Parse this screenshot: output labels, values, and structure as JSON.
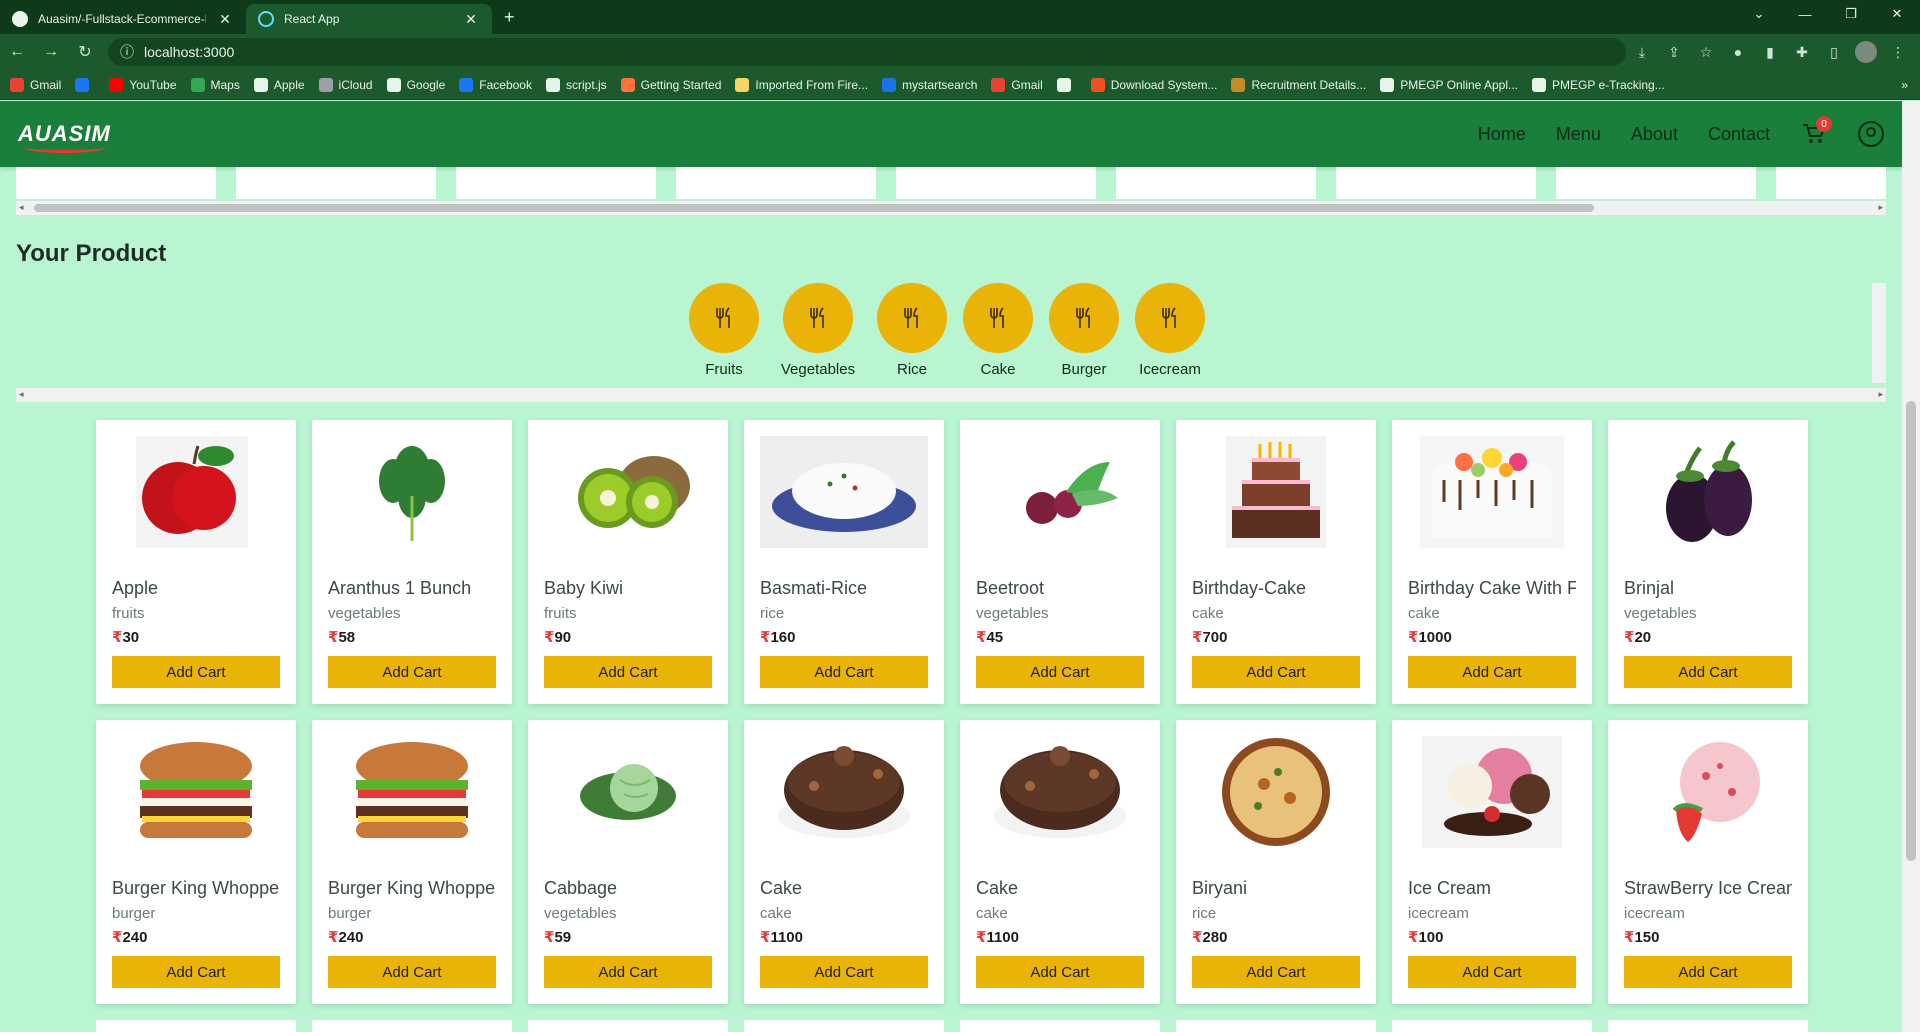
{
  "browser": {
    "tabs": [
      {
        "title": "Auasim/-Fullstack-Ecommerce-R",
        "favicon": "github-icon"
      },
      {
        "title": "React App",
        "favicon": "react-icon"
      }
    ],
    "url": "localhost:3000",
    "bookmarks": [
      {
        "label": "Gmail",
        "color": "#ea4335"
      },
      {
        "label": "",
        "color": "#1877f2"
      },
      {
        "label": "YouTube",
        "color": "#ff0000"
      },
      {
        "label": "Maps",
        "color": "#34a853"
      },
      {
        "label": "Apple",
        "color": "#e8f3ea"
      },
      {
        "label": "iCloud",
        "color": "#9aa0a6"
      },
      {
        "label": "Google",
        "color": "#e8f3ea"
      },
      {
        "label": "Facebook",
        "color": "#1877f2"
      },
      {
        "label": "script.js",
        "color": "#e8f3ea"
      },
      {
        "label": "Getting Started",
        "color": "#ff7139"
      },
      {
        "label": "Imported From Fire...",
        "color": "#f6d365"
      },
      {
        "label": "mystartsearch",
        "color": "#1a73e8"
      },
      {
        "label": "Gmail",
        "color": "#ea4335"
      },
      {
        "label": "",
        "color": "#e8f3ea"
      },
      {
        "label": "Download System...",
        "color": "#f25022"
      },
      {
        "label": "Recruitment Details...",
        "color": "#c58b2b"
      },
      {
        "label": "PMEGP Online Appl...",
        "color": "#e8f3ea"
      },
      {
        "label": "PMEGP e-Tracking...",
        "color": "#e8f3ea"
      }
    ]
  },
  "header": {
    "logo": "AUASIM",
    "nav": [
      "Home",
      "Menu",
      "About",
      "Contact"
    ],
    "cart_count": "0"
  },
  "section_title": "Your Product",
  "categories": [
    "Fruits",
    "Vegetables",
    "Rice",
    "Cake",
    "Burger",
    "Icecream"
  ],
  "currency": "₹",
  "add_cart_label": "Add Cart",
  "products": [
    {
      "name": "Apple",
      "category": "fruits",
      "price": "30",
      "img": "apple"
    },
    {
      "name": "Aranthus 1 Bunch",
      "category": "vegetables",
      "price": "58",
      "img": "greens"
    },
    {
      "name": "Baby Kiwi",
      "category": "fruits",
      "price": "90",
      "img": "kiwi"
    },
    {
      "name": "Basmati-Rice",
      "category": "rice",
      "price": "160",
      "img": "rice"
    },
    {
      "name": "Beetroot",
      "category": "vegetables",
      "price": "45",
      "img": "beet"
    },
    {
      "name": "Birthday-Cake",
      "category": "cake",
      "price": "700",
      "img": "bdaycake"
    },
    {
      "name": "Birthday Cake With F",
      "category": "cake",
      "price": "1000",
      "img": "flowercake"
    },
    {
      "name": "Brinjal",
      "category": "vegetables",
      "price": "20",
      "img": "brinjal"
    },
    {
      "name": "Burger King Whoppe",
      "category": "burger",
      "price": "240",
      "img": "burger"
    },
    {
      "name": "Burger King Whoppe",
      "category": "burger",
      "price": "240",
      "img": "burger"
    },
    {
      "name": "Cabbage",
      "category": "vegetables",
      "price": "59",
      "img": "cabbage"
    },
    {
      "name": "Cake",
      "category": "cake",
      "price": "1100",
      "img": "chococake"
    },
    {
      "name": "Cake",
      "category": "cake",
      "price": "1100",
      "img": "chococake"
    },
    {
      "name": "Biryani",
      "category": "rice",
      "price": "280",
      "img": "biryani"
    },
    {
      "name": "Ice Cream",
      "category": "icecream",
      "price": "100",
      "img": "icecream"
    },
    {
      "name": "StrawBerry Ice Cream",
      "category": "icecream",
      "price": "150",
      "img": "strawberry"
    }
  ],
  "colors": {
    "page_bg": "#b9f5d0",
    "header_bg": "#1a7f3a",
    "accent": "#eab308",
    "price_symbol": "#e53935"
  }
}
